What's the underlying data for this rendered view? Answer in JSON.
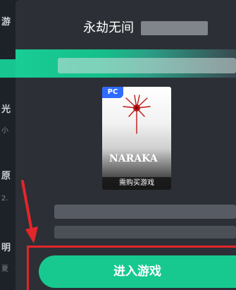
{
  "background_list": [
    {
      "label": "游",
      "sub": ""
    },
    {
      "label": "光",
      "sub": "小"
    },
    {
      "label": "原",
      "sub": "2."
    },
    {
      "label": "明",
      "sub": "夏"
    }
  ],
  "modal": {
    "title": "永劫无间",
    "game_cover": {
      "platform_badge": "PC",
      "logo_text": "NARAKA",
      "footer_text": "需购买游戏"
    },
    "enter_button_label": "进入游戏"
  },
  "colors": {
    "accent_green": "#17c98f",
    "highlight_red": "#e3262a",
    "panel_bg": "#2c3036",
    "badge_blue": "#2f6bff"
  },
  "icons": [
    "flower-icon",
    "arrow-icon"
  ]
}
